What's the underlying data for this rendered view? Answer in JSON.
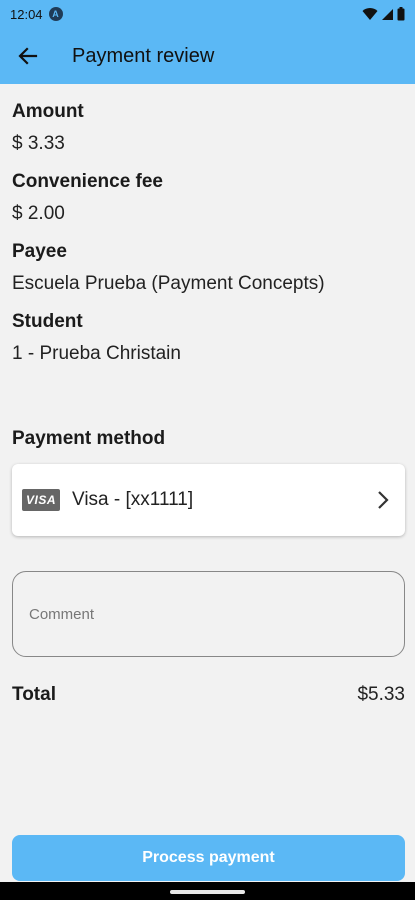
{
  "status_bar": {
    "time": "12:04",
    "badge": "A"
  },
  "app_bar": {
    "title": "Payment review"
  },
  "fields": {
    "amount": {
      "label": "Amount",
      "value": "$ 3.33"
    },
    "fee": {
      "label": "Convenience fee",
      "value": "$ 2.00"
    },
    "payee": {
      "label": "Payee",
      "value": "Escuela Prueba (Payment Concepts)"
    },
    "student": {
      "label": "Student",
      "value": "1 - Prueba Christain"
    }
  },
  "payment_method": {
    "label": "Payment method",
    "card_brand": "VISA",
    "card_text": "Visa - [xx1111]"
  },
  "comment": {
    "placeholder": "Comment",
    "value": ""
  },
  "total": {
    "label": "Total",
    "value": "$5.33"
  },
  "actions": {
    "process_label": "Process payment"
  },
  "colors": {
    "accent": "#5bb8f5",
    "background": "#f2f2f2"
  }
}
